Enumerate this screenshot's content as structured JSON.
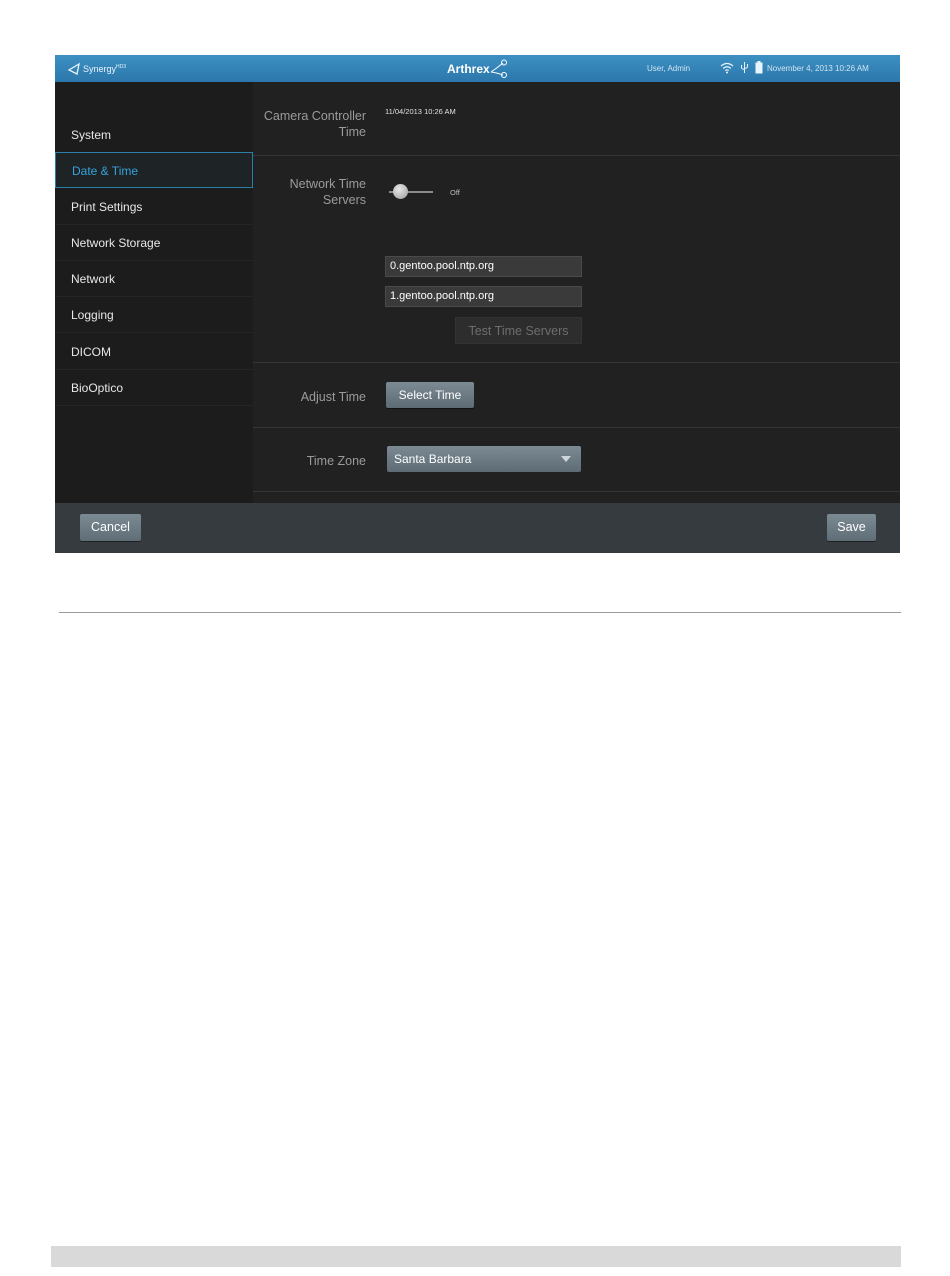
{
  "header": {
    "logo_text": "Synergy",
    "logo_superscript": "HD3",
    "brand": "Arthrex",
    "user": "User, Admin",
    "datetime": "November 4, 2013   10:26 AM",
    "status_icons": [
      "wifi-icon",
      "usb-icon",
      "battery-icon"
    ]
  },
  "sidebar": {
    "items": [
      {
        "label": "System",
        "active": false
      },
      {
        "label": "Date & Time",
        "active": true
      },
      {
        "label": "Print Settings",
        "active": false
      },
      {
        "label": "Network Storage",
        "active": false
      },
      {
        "label": "Network",
        "active": false
      },
      {
        "label": "Logging",
        "active": false
      },
      {
        "label": "DICOM",
        "active": false
      },
      {
        "label": "BioOptico",
        "active": false
      }
    ]
  },
  "main": {
    "camera_controller_time": {
      "label_line1": "Camera Controller",
      "label_line2": "Time",
      "value": "11/04/2013 10:26 AM"
    },
    "network_time_servers": {
      "label_line1": "Network Time",
      "label_line2": "Servers",
      "toggle_state": "Off",
      "servers": [
        "0.gentoo.pool.ntp.org",
        "1.gentoo.pool.ntp.org"
      ],
      "test_button_label": "Test Time Servers"
    },
    "adjust_time": {
      "label": "Adjust Time",
      "button_label": "Select Time"
    },
    "time_zone": {
      "label": "Time Zone",
      "selected": "Santa Barbara"
    }
  },
  "footer": {
    "cancel_label": "Cancel",
    "save_label": "Save"
  },
  "colors": {
    "topbar": "#3389bd",
    "accent": "#36a3dd",
    "panel_bg": "#212121",
    "button": "#6e7c85"
  }
}
